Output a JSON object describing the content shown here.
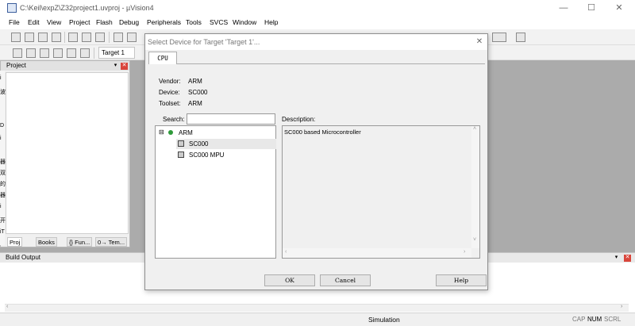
{
  "window": {
    "title": "C:\\Keil\\expZ\\Z32project1.uvproj - µVision4",
    "minimize_glyph": "—",
    "maximize_glyph": "☐",
    "close_glyph": "✕"
  },
  "menu": [
    "File",
    "Edit",
    "View",
    "Project",
    "Flash",
    "Debug",
    "Peripherals",
    "Tools",
    "SVCS",
    "Window",
    "Help"
  ],
  "toolbar2": {
    "target": "Target 1"
  },
  "project_panel": {
    "title": "Project",
    "tabs": [
      "Proj",
      "Books",
      "{} Fun...",
      "0→ Tem..."
    ]
  },
  "build_output": {
    "title": "Build Output"
  },
  "statusbar": {
    "mode": "Simulation",
    "indicators": [
      "CAP",
      "NUM",
      "SCRL"
    ]
  },
  "dialog": {
    "title": "Select Device for Target 'Target 1'...",
    "tab": "CPU",
    "vendor_label": "Vendor:",
    "vendor": "ARM",
    "device_label": "Device:",
    "device": "SC000",
    "toolset_label": "Toolset:",
    "toolset": "ARM",
    "search_label": "Search:",
    "search_value": "",
    "description_label": "Description:",
    "description": "SC000 based Microcontroller",
    "tree": {
      "expander": "⊟",
      "vendor_node": "ARM",
      "children": [
        "SC000",
        "SC000 MPU"
      ]
    },
    "buttons": {
      "ok": "OK",
      "cancel": "Cancel",
      "help": "Help"
    }
  },
  "left_edge_fragments": [
    "i",
    "波",
    "D",
    "i",
    "器",
    "双",
    "的",
    "器",
    "i",
    "开",
    "iT"
  ],
  "colors": {
    "accent": "#3b5d9c",
    "close_red": "#d9453b",
    "selected_item": "#e8e8e8"
  }
}
